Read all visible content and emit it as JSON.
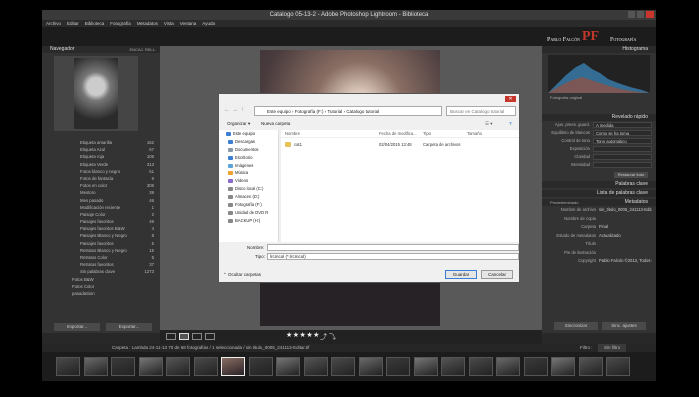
{
  "window": {
    "title": "Catalogo 05-13-2 - Adobe Photoshop Lightroom - Biblioteca"
  },
  "menu": [
    "Archivo",
    "Editar",
    "Biblioteca",
    "Fotografía",
    "Metadatos",
    "Vista",
    "Ventana",
    "Ayuda"
  ],
  "brand": {
    "name": "Pablo Falcón",
    "suffix": "Fotografía",
    "monogram": "PF"
  },
  "left": {
    "navigator": "Navegador",
    "nav_opts": [
      "ENCAJ.",
      "RELL."
    ],
    "collections": [
      {
        "n": "Etiqueta amarilla",
        "c": "152"
      },
      {
        "n": "Etiqueta Azul",
        "c": "67"
      },
      {
        "n": "Etiqueta roja",
        "c": "106"
      },
      {
        "n": "Etiqueta Verde",
        "c": "313"
      },
      {
        "n": "Fotos blanco y negro",
        "c": "61"
      },
      {
        "n": "Fotos de fantasía",
        "c": "6"
      },
      {
        "n": "Fotos en color",
        "c": "306"
      },
      {
        "n": "Mestoro",
        "c": "39"
      },
      {
        "n": "Mes pasado",
        "c": "46"
      },
      {
        "n": "Modificación reciente",
        "c": "1"
      },
      {
        "n": "Paisaje Color",
        "c": "2"
      },
      {
        "n": "Paisajes favoritos",
        "c": "46"
      },
      {
        "n": "Paisajes favoritos B&W",
        "c": "4"
      },
      {
        "n": "Paisajes Blanco y Negro",
        "c": "8"
      },
      {
        "n": "Paisajes favoritos",
        "c": "5"
      },
      {
        "n": "Retratos Blanco y Negro",
        "c": "15"
      },
      {
        "n": "Retratos Color",
        "c": "5"
      },
      {
        "n": "Retratos favoritos",
        "c": "37"
      },
      {
        "n": "Sin palabras clave",
        "c": "1273"
      },
      {
        "n": "Fotos B&W",
        "c": ""
      },
      {
        "n": "Fotos Color",
        "c": ""
      },
      {
        "n": "pasadaSion",
        "c": ""
      }
    ],
    "import_label": "Importar...",
    "export_label": "Exportar..."
  },
  "right": {
    "histogram": "Histograma",
    "orig_photo": "Fotografía original",
    "quick_dev": "Revelado rápido",
    "qd_rows": [
      {
        "k": "Ajus. prees. guard.",
        "v": "A medida"
      },
      {
        "k": "Equilibrio de blancos",
        "v": "Como se ha toma"
      },
      {
        "k": "Control de tono",
        "v": "Tono automático"
      },
      {
        "k": "Exposición",
        "v": ""
      },
      {
        "k": "Claridad",
        "v": ""
      },
      {
        "k": "Intensidad",
        "v": ""
      }
    ],
    "reset": "Restaurar todo",
    "keywords": "Palabras clave",
    "keyword_list": "Lista de palabras clave",
    "metadata": "Metadatos",
    "predet": "Predeterminado",
    "meta_rows": [
      {
        "k": "Nombre de archivo",
        "v": "sin_titulo_0005_241113-Editar.tif"
      },
      {
        "k": "Nombre de copia",
        "v": ""
      },
      {
        "k": "Carpeta",
        "v": "Final"
      },
      {
        "k": "Estado de metadatos",
        "v": "Actualizado"
      },
      {
        "k": "Título",
        "v": ""
      },
      {
        "k": "Pie de ilustración",
        "v": ""
      },
      {
        "k": "Copyright",
        "v": "Pablo Falcón ©2013, Todos los derechos"
      }
    ],
    "sync": "Sincronizar",
    "sync_settings": "Sinc. ajustes"
  },
  "filmbar": {
    "text": "Carpeta : Lambda 24-11-13   70 de 68 fotografías / 1 seleccionada / sin titulo_0005_241113-Editar.tif",
    "filter": "Filtro :",
    "filter_val": "Sin filtro"
  },
  "dialog": {
    "address": [
      "Este equipo",
      "Fotografía (F:)",
      "Tutorial",
      "Catalogo tutorial"
    ],
    "search": "Buscar en Catalogo tutorial",
    "organize": "Organizar ▾",
    "new_folder": "Nueva carpeta",
    "tree": [
      {
        "n": "Este equipo",
        "c": "#3c7fd2"
      },
      {
        "n": "Descargas",
        "c": "#3c7fd2"
      },
      {
        "n": "Documentos",
        "c": "#8899aa"
      },
      {
        "n": "Escritorio",
        "c": "#3c7fd2"
      },
      {
        "n": "Imágenes",
        "c": "#59a4d9"
      },
      {
        "n": "Música",
        "c": "#f0a030"
      },
      {
        "n": "Vídeos",
        "c": "#8a6ad0"
      },
      {
        "n": "Disco local (C:)",
        "c": "#888888"
      },
      {
        "n": "Almacen (D:)",
        "c": "#888888"
      },
      {
        "n": "Fotografía (F:)",
        "c": "#888888"
      },
      {
        "n": "Unidad de DVD R",
        "c": "#888888"
      },
      {
        "n": "BACKUP (H:)",
        "c": "#888888"
      }
    ],
    "cols": [
      "Nombre",
      "Fecha de modifica...",
      "Tipo",
      "Tamaño"
    ],
    "files": [
      {
        "name": "cat1",
        "date": "02/04/2015 13:48",
        "type": "Carpeta de archivos",
        "size": ""
      }
    ],
    "name_label": "Nombre:",
    "type_label": "Tipo:",
    "type_value": "lrcmcol (*.lrcmcol)",
    "hide": "Ocultar carpetas",
    "save": "Guardar",
    "cancel": "Cancelar"
  }
}
